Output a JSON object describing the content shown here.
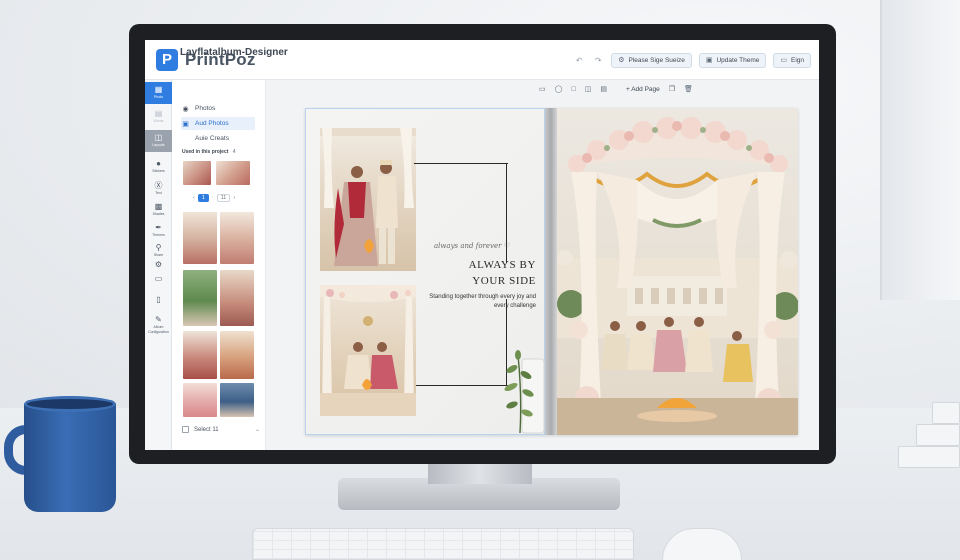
{
  "app": {
    "logo_letter": "P",
    "name": "PrintPoz",
    "document_title": "Layflatalbum-Designer"
  },
  "toolbar": {
    "buttons": [
      {
        "label": "Please Sige Sueize",
        "icon": "gear-icon"
      },
      {
        "label": "Update Theme",
        "icon": "save-icon"
      },
      {
        "label": "Eign",
        "icon": "monitor-icon"
      }
    ]
  },
  "rail": {
    "items": [
      {
        "label": "Photo",
        "icon": "image-icon",
        "state": "active"
      },
      {
        "label": "Words",
        "icon": "text-icon",
        "state": "muted"
      },
      {
        "label": "Layouts",
        "icon": "layout-icon",
        "state": "grey"
      },
      {
        "label": "Stickers",
        "icon": "sticker-icon",
        "state": "normal"
      },
      {
        "label": "Text",
        "icon": "text-box-icon",
        "state": "normal"
      },
      {
        "label": "Shades",
        "icon": "shade-icon",
        "state": "normal"
      },
      {
        "label": "Themes",
        "icon": "brush-icon",
        "state": "normal"
      },
      {
        "label": "Share",
        "icon": "pin-icon",
        "state": "normal"
      },
      {
        "label": "",
        "icon": "settings-icon",
        "state": "normal"
      },
      {
        "label": "",
        "icon": "monitor-icon",
        "state": "normal"
      },
      {
        "label": "",
        "icon": "terminal-icon",
        "state": "normal"
      },
      {
        "label": "Album Configuration",
        "icon": "wrench-icon",
        "state": "normal"
      }
    ]
  },
  "panel": {
    "photos_label": "Photos",
    "add_photos_label": "Aud Photos",
    "auto_create_label": "Auie Creats",
    "used_label": "Used in this project",
    "used_count": "4",
    "pager": {
      "current": "1",
      "total": "11"
    },
    "select_label": "Select 11"
  },
  "canvas": {
    "add_page_label": "+ Add Page"
  },
  "spread": {
    "script_line": "always and forever ♡",
    "headline_1": "ALWAYS BY",
    "headline_2": "YOUR SIDE",
    "subtext": "Standing together through every joy and every challenge"
  },
  "colors": {
    "accent": "#2f7de1",
    "mug": "#2f5c9e",
    "bride_red": "#b02a3a"
  }
}
